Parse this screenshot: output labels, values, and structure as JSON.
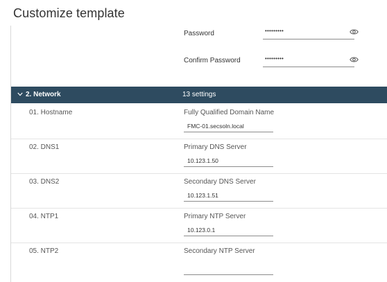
{
  "page": {
    "title": "Customize template"
  },
  "password_fields": [
    {
      "label": "Password",
      "value": "•••••••••",
      "icon": "eye-icon"
    },
    {
      "label": "Confirm Password",
      "value": "•••••••••",
      "icon": "eye-icon"
    }
  ],
  "section": {
    "title": "2. Network",
    "count": "13 settings",
    "expanded": true,
    "header_color": "#2e4b60"
  },
  "settings": [
    {
      "label": "01. Hostname",
      "description": "Fully Qualified Domain Name",
      "value": "FMC-01.secsoln.local"
    },
    {
      "label": "02. DNS1",
      "description": "Primary DNS Server",
      "value": "10.123.1.50"
    },
    {
      "label": "03. DNS2",
      "description": "Secondary DNS Server",
      "value": "10.123.1.51"
    },
    {
      "label": "04. NTP1",
      "description": "Primary NTP Server",
      "value": "10.123.0.1"
    },
    {
      "label": "05. NTP2",
      "description": "Secondary NTP Server",
      "value": ""
    }
  ]
}
